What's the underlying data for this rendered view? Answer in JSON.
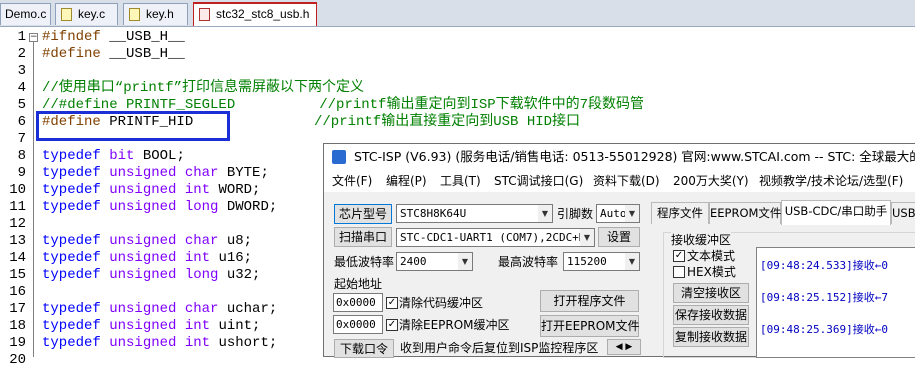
{
  "editor": {
    "tabs": [
      {
        "label": "Demo.c"
      },
      {
        "label": "key.c"
      },
      {
        "label": "key.h"
      },
      {
        "label": "stc32_stc8_usb.h"
      }
    ],
    "lines": [
      {
        "n": "1",
        "pp": "#ifndef",
        "rest": " __USB_H__"
      },
      {
        "n": "2",
        "pp": "#define",
        "rest": " __USB_H__"
      },
      {
        "n": "3"
      },
      {
        "n": "4",
        "cm": "//使用串口“printf”打印信息需屏蔽以下两个定义"
      },
      {
        "n": "5",
        "cm": "//#define PRINTF_SEGLED          //printf输出重定向到ISP下载软件中的7段数码管"
      },
      {
        "n": "6",
        "pp": "#define",
        "rest": " PRINTF_HID",
        "cm": "//printf输出直接重定向到USB HID接口"
      },
      {
        "n": "7"
      },
      {
        "n": "8",
        "kw": "typedef",
        "tp": "bit",
        "name": "BOOL;"
      },
      {
        "n": "9",
        "kw": "typedef",
        "tp": "unsigned char",
        "name": "BYTE;"
      },
      {
        "n": "10",
        "kw": "typedef",
        "tp": "unsigned int",
        "name": "WORD;"
      },
      {
        "n": "11",
        "kw": "typedef",
        "tp": "unsigned long",
        "name": "DWORD;"
      },
      {
        "n": "12"
      },
      {
        "n": "13",
        "kw": "typedef",
        "tp": "unsigned char",
        "name": "u8;"
      },
      {
        "n": "14",
        "kw": "typedef",
        "tp": "unsigned int",
        "name": "u16;"
      },
      {
        "n": "15",
        "kw": "typedef",
        "tp": "unsigned long",
        "name": "u32;"
      },
      {
        "n": "16"
      },
      {
        "n": "17",
        "kw": "typedef",
        "tp": "unsigned char",
        "name": "uchar;"
      },
      {
        "n": "18",
        "kw": "typedef",
        "tp": "unsigned int",
        "name": "uint;"
      },
      {
        "n": "19",
        "kw": "typedef",
        "tp": "unsigned int",
        "name": "ushort;"
      },
      {
        "n": "20"
      }
    ]
  },
  "isp": {
    "title": "STC-ISP (V6.93) (服务电话/销售电话: 0513-55012928) 官网:www.STCAI.com  -- STC: 全球最大的8051单片机设计公司",
    "menu": [
      "文件(F)",
      "编程(P)",
      "工具(T)",
      "STC调试接口(G)",
      "资料下载(D)",
      "200万大奖(Y)",
      "视频教学/技术论坛/选型(F)"
    ],
    "mcu_button": "芯片型号",
    "mcu_value": "STC8H8K64U",
    "pin_label": "引脚数",
    "pin_value": "Auto",
    "scan_button": "扫描串口",
    "port_value": "STC-CDC1-UART1 (COM7),2CDC+HID",
    "settings_button": "设置",
    "min_baud_label": "最低波特率",
    "min_baud_value": "2400",
    "max_baud_label": "最高波特率",
    "max_baud_value": "115200",
    "start_addr_label": "起始地址",
    "addr1": "0x0000",
    "clear_code_label": "清除代码缓冲区",
    "open_program_button": "打开程序文件",
    "addr2": "0x0000",
    "clear_eeprom_label": "清除EEPROM缓冲区",
    "open_eeprom_button": "打开EEPROM文件",
    "download_button": "下载口令",
    "download_hint": "收到用户命令后复位到ISP监控程序区",
    "right_tabs": [
      "程序文件",
      "EEPROM文件",
      "USB-CDC/串口助手",
      "USB-"
    ],
    "recv_group_label": "接收缓冲区",
    "text_mode_label": "文本模式",
    "hex_mode_label": "HEX模式",
    "clear_recv_button": "清空接收区",
    "save_recv_button": "保存接收数据",
    "copy_recv_button": "复制接收数据",
    "received": [
      "[09:48:24.533]接收←0",
      "[09:48:25.152]接收←7",
      "[09:48:25.369]接收←0"
    ]
  }
}
